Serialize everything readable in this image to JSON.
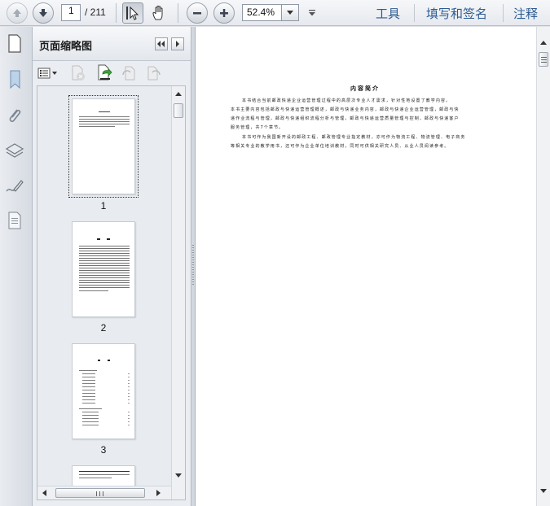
{
  "toolbar": {
    "page_current": "1",
    "page_total": "/ 211",
    "zoom": "52.4%",
    "right_links": [
      "工具",
      "填写和签名",
      "注释"
    ]
  },
  "sidebar": {
    "title": "页面缩略图",
    "rail_icons": [
      "bookmark-icon",
      "attachment-icon",
      "layers-icon",
      "signature-icon",
      "content-icon"
    ]
  },
  "thumbnails": [
    {
      "number": "1",
      "selected": true
    },
    {
      "number": "2",
      "selected": false
    },
    {
      "number": "3",
      "selected": false
    }
  ],
  "document": {
    "title": "内容简介",
    "lines": [
      "本书结合当前邮政快递企业运营管理过程中的高层次专业人才需求，针对性地设置了教学内容。",
      "本书主要内容包括邮政与快递运营管理概述，邮政与快递业务内容，邮政与快递企业运营管理，邮政与快",
      "递作业流程与管理，邮政与快递组织流程分析与管理，邮政与快递运营质量管理与控制，邮政与快递客户",
      "服务管理，共7个章节。",
      "本书可作为我国新开设的邮政工程、邮政管理专业指定教材，亦可作为物流工程、物流管理、电子商务",
      "等相关专业的教学用书，还可作为企业单位培训教材，同时可供相关研究人员、从业人员阅读参考。"
    ]
  }
}
